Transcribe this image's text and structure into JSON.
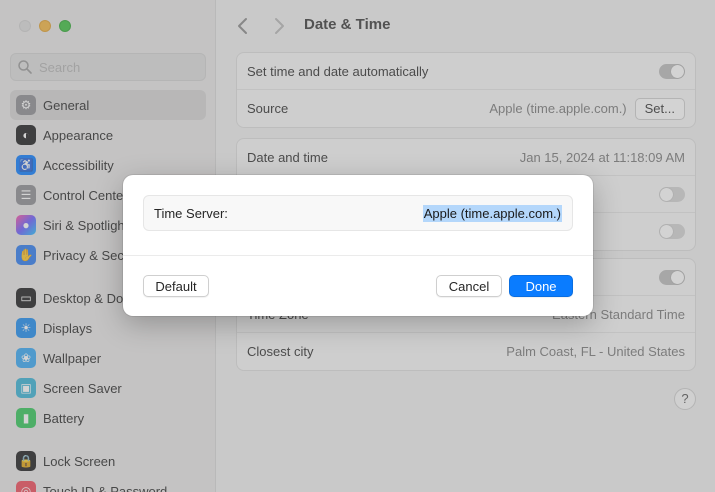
{
  "window": {
    "title": "Date & Time"
  },
  "search": {
    "placeholder": "Search"
  },
  "sidebar": {
    "items": [
      {
        "label": "General",
        "icon": "gear-icon",
        "color": "#8e8e93",
        "active": true
      },
      {
        "label": "Appearance",
        "icon": "appearance-icon",
        "color": "#1c1c1e"
      },
      {
        "label": "Accessibility",
        "icon": "accessibility-icon",
        "color": "#0a7cff"
      },
      {
        "label": "Control Center",
        "icon": "control-center-icon",
        "color": "#8e8e93"
      },
      {
        "label": "Siri & Spotlight",
        "icon": "siri-icon",
        "color": "#a052e0"
      },
      {
        "label": "Privacy & Security",
        "icon": "hand-icon",
        "color": "#2d7bf0"
      },
      {
        "label": "Desktop & Dock",
        "icon": "dock-icon",
        "color": "#1c1c1e"
      },
      {
        "label": "Displays",
        "icon": "sun-icon",
        "color": "#1d8cf0"
      },
      {
        "label": "Wallpaper",
        "icon": "wallpaper-icon",
        "color": "#36a8f5"
      },
      {
        "label": "Screen Saver",
        "icon": "screen-saver-icon",
        "color": "#38b2d6"
      },
      {
        "label": "Battery",
        "icon": "battery-icon",
        "color": "#34c759"
      },
      {
        "label": "Lock Screen",
        "icon": "lock-icon",
        "color": "#1c1c1e"
      },
      {
        "label": "Touch ID & Password",
        "icon": "fingerprint-icon",
        "color": "#f04a5a"
      }
    ]
  },
  "groups": {
    "auto": {
      "set_auto_label": "Set time and date automatically",
      "source_label": "Source",
      "source_value": "Apple (time.apple.com.)",
      "set_button": "Set..."
    },
    "datetime": {
      "label": "Date and time",
      "value": "Jan 15, 2024 at 11:18:09 AM"
    },
    "timezone": {
      "tz_label": "Time Zone",
      "tz_value": "Eastern Standard Time",
      "city_label": "Closest city",
      "city_value": "Palm Coast, FL - United States"
    }
  },
  "help": "?",
  "sheet": {
    "field_label": "Time Server:",
    "field_value": "Apple (time.apple.com.)",
    "default_label": "Default",
    "cancel_label": "Cancel",
    "done_label": "Done"
  },
  "colors": {
    "accent": "#0a7cff",
    "selection": "#b4d7fb"
  }
}
